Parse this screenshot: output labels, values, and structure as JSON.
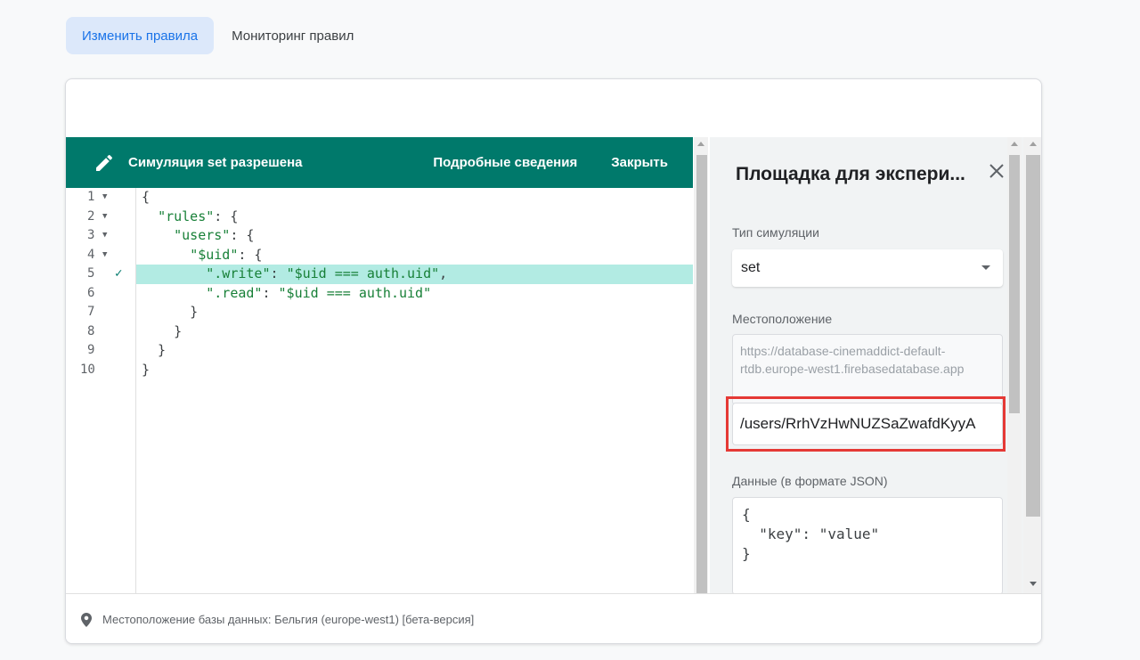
{
  "tabs": [
    {
      "label": "Изменить правила",
      "active": true
    },
    {
      "label": "Мониторинг правил",
      "active": false
    }
  ],
  "simulation_bar": {
    "icon": "pencil-icon",
    "message": "Симуляция set разрешена",
    "details_button": "Подробные сведения",
    "close_button": "Закрыть",
    "color": "#00796b"
  },
  "editor": {
    "line_numbers": [
      "1",
      "2",
      "3",
      "4",
      "5",
      "6",
      "7",
      "8",
      "9",
      "10"
    ],
    "highlighted_line": 5,
    "highlight_color": "#b2ebe3"
  },
  "playground": {
    "title": "Площадка для экспери...",
    "close_icon": "close-icon",
    "simulation_type_label": "Тип симуляции",
    "simulation_type_value": "set",
    "location_label": "Местоположение",
    "location_base_url": "https://database-cinemaddict-default-rtdb.europe-west1.firebasedatabase.app",
    "location_path": "/users/RrhVzHwNUZSaZwafdKyyA",
    "data_label": "Данные (в формате JSON)",
    "data_lines": [
      "{",
      "  \"key\": \"value\"",
      "}"
    ],
    "highlight_border_color": "#e53935"
  },
  "footer": {
    "icon": "location-pin-icon",
    "text": "Местоположение базы данных: Бельгия (europe-west1) [бета-версия]"
  }
}
